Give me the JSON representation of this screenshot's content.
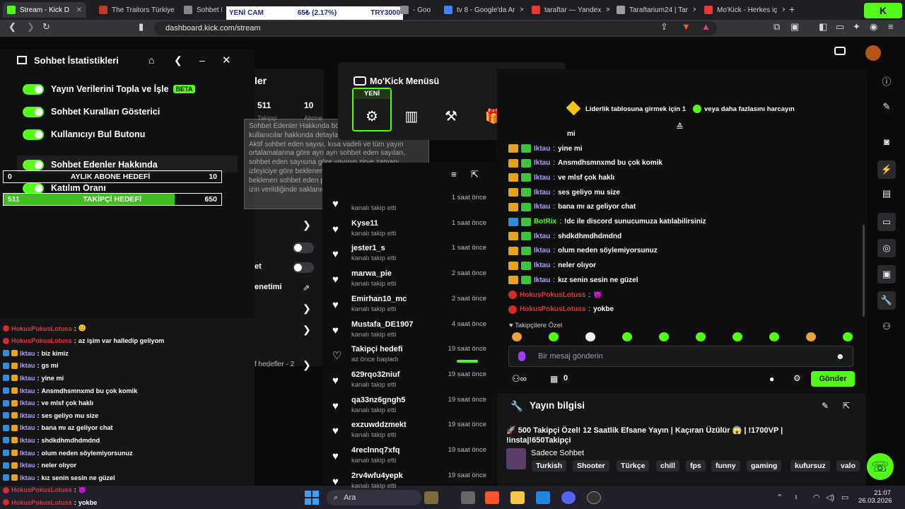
{
  "browser": {
    "tabs": [
      {
        "label": "Stream - Kick D",
        "color": "#53fc18",
        "active": true
      },
      {
        "label": "The Traitors Türkiye",
        "color": "#c0392b"
      },
      {
        "label": "Sohbet Bo",
        "color": "#888888"
      },
      {
        "label": "- Goo",
        "color": "#888888"
      },
      {
        "label": "tv 8 - Google'da Ar",
        "color": "#4285f4"
      },
      {
        "label": "taraftar — Yandex",
        "color": "#e53935"
      },
      {
        "label": "Taraftarium24 | Tar",
        "color": "#9e9e9e"
      },
      {
        "label": "Mo'Kick - Herkes iç",
        "color": "#e53935"
      }
    ],
    "new_tab": "+",
    "url": "dashboard.kick.com/stream"
  },
  "ticker": {
    "symbol": "YENİ CAM",
    "change": "65₺ (2.17%)",
    "pair": "TRY3000"
  },
  "left_panel": {
    "title": "Sohbet İstatistikleri",
    "settings": [
      {
        "label": "Yayın Verilerini Topla ve İşle",
        "badge": "BETA",
        "on": true
      },
      {
        "label": "Sohbet Kuralları Gösterici",
        "on": true
      },
      {
        "label": "Kullanıcıyı Bul Butonu",
        "on": true
      },
      {
        "label": "Sohbet Edenler Hakkında",
        "on": true
      },
      {
        "label": "Katılım Oranı",
        "on": true
      }
    ],
    "goals": [
      {
        "left": "0",
        "label": "AYLIK ABONE HEDEFİ",
        "right": "10",
        "progress": 0
      },
      {
        "left": "511",
        "label": "TAKİPÇİ HEDEFİ",
        "right": "650",
        "progress": 0.786
      }
    ]
  },
  "tooltip": {
    "text": "Sohbet Edenler Hakkında bölümü, sohbete katılan kullanıcılar hakkında detaylar ve hesaplamalar sunar. Aktif sohbet eden sayısı, kısa vadeli ve tüm yayın ortalamalarına göre ayrı ayrı sohbet eden sayıları, sohbet eden sayısına göre yayının zirve zamanı, izleyiciye göre beklenen sohbet eden sayısı ve beklenen sohbet eden puanı gibi veriler, bu ayar için izin verildiğinde saklanır."
  },
  "bg_stats": {
    "heading": "ler",
    "followers": "511",
    "followers_label": "Takipçi",
    "subs": "10",
    "subs_label": "Abone",
    "menu_label": "enetimi",
    "partial_label": "et",
    "goals_label": "f hedefler - 2"
  },
  "mokick_menu": {
    "title": "Mo'Kick Menüsü",
    "new_badge": "YENİ"
  },
  "activity": [
    {
      "name": "",
      "sub": "kanalı takip etti",
      "time": "1 saat önce"
    },
    {
      "name": "Kyse11",
      "sub": "kanalı takip etti",
      "time": "1 saat önce"
    },
    {
      "name": "jester1_s",
      "sub": "kanalı takip etti",
      "time": "1 saat önce"
    },
    {
      "name": "marwa_pie",
      "sub": "kanalı takip etti",
      "time": "2 saat önce"
    },
    {
      "name": "Emirhan10_mc",
      "sub": "kanalı takip etti",
      "time": "2 saat önce"
    },
    {
      "name": "Mustafa_DE1907",
      "sub": "kanalı takip etti",
      "time": "4 saat önce"
    },
    {
      "name": "Takipçi hedefi",
      "sub": "az önce başladı",
      "time": "19 saat önce",
      "goal": true
    },
    {
      "name": "629rqo32niuf",
      "sub": "kanalı takip etti",
      "time": "19 saat önce"
    },
    {
      "name": "qa33nz6gngh5",
      "sub": "kanalı takip etti",
      "time": "19 saat önce"
    },
    {
      "name": "exzuwddzmekt",
      "sub": "kanalı takip etti",
      "time": "19 saat önce"
    },
    {
      "name": "4reclnnq7xfq",
      "sub": "kanalı takip etti",
      "time": "19 saat önce"
    },
    {
      "name": "2rv4wfu4yepk",
      "sub": "kanalı takip etti",
      "time": "19 saat önce"
    }
  ],
  "chat": {
    "leaderboard": "Liderlik tablosuna girmek için 1",
    "leaderboard_tail": "veya daha fazlasını harcayın",
    "partial": "mi",
    "messages": [
      {
        "user": "Iktau",
        "type": "iktau",
        "text": "yine mi"
      },
      {
        "user": "Iktau",
        "type": "iktau",
        "text": "Ansmdhsmnxmd bu çok komik"
      },
      {
        "user": "Iktau",
        "type": "iktau",
        "text": "ve mlsf çok haklı"
      },
      {
        "user": "Iktau",
        "type": "iktau",
        "text": "ses geliyo mu size"
      },
      {
        "user": "Iktau",
        "type": "iktau",
        "text": "bana mı az geliyor chat"
      },
      {
        "user": "BotRix",
        "type": "bot",
        "text": "!dc ile discord sunucumuza katılabilirsiniz"
      },
      {
        "user": "Iktau",
        "type": "iktau",
        "text": "shdkdhmdhdmdnd"
      },
      {
        "user": "Iktau",
        "type": "iktau",
        "text": "olum neden söylemiyorsunuz"
      },
      {
        "user": "Iktau",
        "type": "iktau",
        "text": "neler olıyor"
      },
      {
        "user": "Iktau",
        "type": "iktau",
        "text": "kız senin sesin ne güzel"
      },
      {
        "user": "HokusPokusLotuss",
        "type": "hokus",
        "text": "😈"
      },
      {
        "user": "HokusPokusLotuss",
        "type": "hokus",
        "text": "yokbe"
      }
    ],
    "followers_only": "Takipçilere Özel",
    "placeholder": "Bir mesaj gönderin",
    "points": "0",
    "send": "Gönder"
  },
  "old_chat": [
    {
      "user": "HokusPokusLotuss",
      "type": "hokus",
      "text": "😊"
    },
    {
      "user": "HokusPokusLotuss",
      "type": "hokus",
      "text": "az işim var halledip geliyom"
    },
    {
      "user": "Iktau",
      "type": "iktau",
      "text": "biz kimiz"
    },
    {
      "user": "Iktau",
      "type": "iktau",
      "text": "gs mi"
    },
    {
      "user": "Iktau",
      "type": "iktau",
      "text": "yine mi"
    },
    {
      "user": "Iktau",
      "type": "iktau",
      "text": "Ansmdhsmnxmd bu çok komik"
    },
    {
      "user": "Iktau",
      "type": "iktau",
      "text": "ve mlsf çok haklı"
    },
    {
      "user": "Iktau",
      "type": "iktau",
      "text": "ses geliyo mu size"
    },
    {
      "user": "Iktau",
      "type": "iktau",
      "text": "bana mı az geliyor chat"
    },
    {
      "user": "Iktau",
      "type": "iktau",
      "text": "shdkdhmdhdmdnd"
    },
    {
      "user": "Iktau",
      "type": "iktau",
      "text": "olum neden söylemiyorsunuz"
    },
    {
      "user": "Iktau",
      "type": "iktau",
      "text": "neler olıyor"
    },
    {
      "user": "Iktau",
      "type": "iktau",
      "text": "kız senin sesin ne güzel"
    },
    {
      "user": "HokusPokusLotuss",
      "type": "hokus",
      "text": "😈"
    },
    {
      "user": "HokusPokusLotuss",
      "type": "hokus",
      "text": "yokbe"
    }
  ],
  "stream_info": {
    "heading": "Yayın bilgisi",
    "title": "🚀 500 Takipçi Özel! 12 Saatlik Efsane Yayın | Kaçıran Üzülür 😱 | !1700VP | !insta|!650Takipçi",
    "category": "Sadece Sohbet",
    "tags": [
      "Turkish",
      "Shooter",
      "Türkçe",
      "chill",
      "fps",
      "funny",
      "gaming",
      "kufursuz",
      "valo"
    ]
  },
  "taskbar": {
    "search": "Ara",
    "time": "21:07",
    "date": "26.03.2026"
  },
  "colors": {
    "accent": "#53fc18",
    "bg": "#0b0b0c"
  }
}
